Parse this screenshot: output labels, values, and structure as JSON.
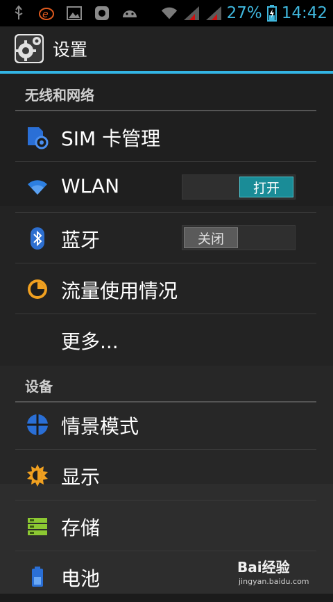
{
  "status_bar": {
    "battery": "27%",
    "time": "14:42",
    "icons": [
      "usb-icon",
      "e-app-icon",
      "image-icon",
      "huawei-icon",
      "android-icon",
      "wifi-icon",
      "signal-1-icon",
      "signal-2-icon",
      "battery-icon"
    ],
    "accent": "#3fb6dc"
  },
  "action_bar": {
    "title": "设置",
    "icon": "settings-gear-icon",
    "accent": "#33b5e5"
  },
  "sections": {
    "wireless": {
      "header": "无线和网络",
      "items": [
        {
          "label": "SIM 卡管理",
          "icon": "sim-card-icon"
        },
        {
          "label": "WLAN",
          "icon": "wifi-icon",
          "toggle": "打开",
          "state": "on"
        },
        {
          "label": "蓝牙",
          "icon": "bluetooth-icon",
          "toggle": "关闭",
          "state": "off"
        },
        {
          "label": "流量使用情况",
          "icon": "data-usage-icon"
        },
        {
          "label": "更多..."
        }
      ]
    },
    "device": {
      "header": "设备",
      "items": [
        {
          "label": "情景模式",
          "icon": "profile-mode-icon"
        },
        {
          "label": "显示",
          "icon": "display-brightness-icon"
        },
        {
          "label": "存储",
          "icon": "storage-icon"
        },
        {
          "label": "电池",
          "icon": "battery-icon"
        }
      ]
    }
  },
  "watermark": {
    "logo": "Bai经验",
    "url": "jingyan.baidu.com"
  }
}
